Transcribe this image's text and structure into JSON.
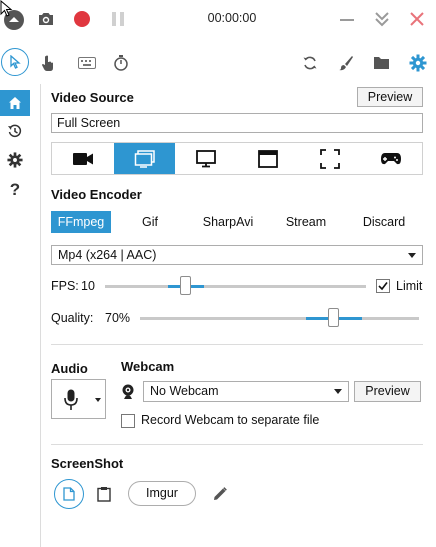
{
  "titlebar": {
    "timer": "00:00:00",
    "colors": {
      "record": "#e0373f",
      "close": "#e8737a",
      "accent": "#2e96d1"
    }
  },
  "toolbar": {
    "icons": [
      "cursor-icon",
      "touch-icon",
      "keyboard-icon",
      "stopwatch-icon",
      "refresh-icon",
      "brush-icon",
      "folder-icon",
      "settings-gear-icon"
    ]
  },
  "rail": {
    "items": [
      "home-icon",
      "history-icon",
      "settings-icon",
      "help-icon"
    ],
    "help_glyph": "?"
  },
  "video_source": {
    "title": "Video Source",
    "preview_label": "Preview",
    "value": "Full Screen",
    "modes": [
      "camera",
      "screen",
      "monitor",
      "window",
      "region",
      "gamepad"
    ],
    "selected_mode": "screen"
  },
  "video_encoder": {
    "title": "Video Encoder",
    "tabs": [
      "FFmpeg",
      "Gif",
      "SharpAvi",
      "Stream",
      "Discard"
    ],
    "selected_tab": "FFmpeg",
    "codec": "Mp4 (x264 | AAC)",
    "fps_label": "FPS:",
    "fps_value": "10",
    "limit_label": "Limit",
    "limit_checked": true,
    "quality_label": "Quality:",
    "quality_value": "70%"
  },
  "audio": {
    "title": "Audio"
  },
  "webcam": {
    "title": "Webcam",
    "selected": "No Webcam",
    "preview_label": "Preview",
    "separate_label": "Record Webcam to separate file",
    "separate_checked": false
  },
  "screenshot": {
    "title": "ScreenShot",
    "imgur_label": "Imgur"
  }
}
